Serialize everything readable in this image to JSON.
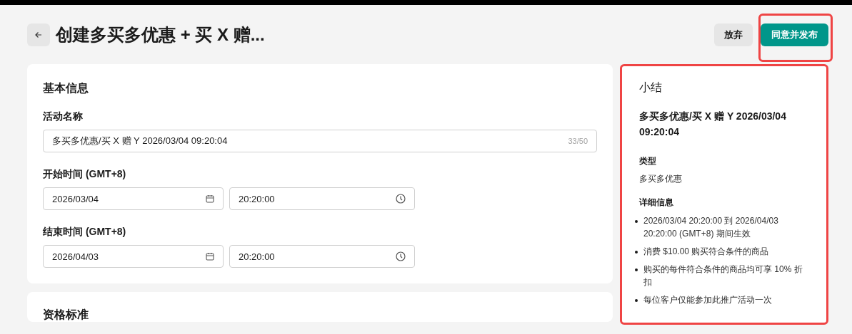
{
  "header": {
    "title": "创建多买多优惠 + 买 X 赠...",
    "buttons": [
      {
        "label": "放弃",
        "kind": "secondary",
        "highlighted": false
      },
      {
        "label": "同意并发布",
        "kind": "primary",
        "highlighted": true
      }
    ]
  },
  "basic_info": {
    "title": "基本信息",
    "name_field": {
      "label": "活动名称",
      "value": "多买多优惠/买 X 赠 Y 2026/03/04 09:20:04",
      "counter": "33/50"
    },
    "time_fields": [
      {
        "label": "开始时间 (GMT+8)",
        "date": "2026/03/04",
        "time": "20:20:00"
      },
      {
        "label": "结束时间 (GMT+8)",
        "date": "2026/04/03",
        "time": "20:20:00"
      }
    ]
  },
  "next_section": {
    "title": "资格标准"
  },
  "summary": {
    "title": "小结",
    "highlighted": true,
    "name": "多买多优惠/买 X 赠 Y 2026/03/04 09:20:04",
    "type_label": "类型",
    "type_value": "多买多优惠",
    "details_label": "详细信息",
    "details": [
      "2026/03/04 20:20:00 到 2026/04/03 20:20:00 (GMT+8) 期间生效",
      "消费 $10.00 购买符合条件的商品",
      "购买的每件符合条件的商品均可享 10% 折扣",
      "每位客户仅能参加此推广活动一次"
    ]
  }
}
